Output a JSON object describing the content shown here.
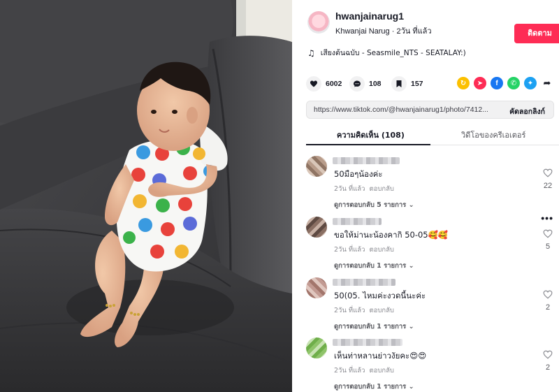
{
  "author": {
    "username": "hwanjainarug1",
    "display_name": "Khwanjai Narug",
    "time_ago": "2วัน ที่แล้ว",
    "follow_label": "ติดตาม"
  },
  "music": {
    "label": "เสียงต้นฉบับ - Seasmile_NTS - SEATALAY:)"
  },
  "stats": {
    "likes": "6002",
    "comments": "108",
    "saves": "157"
  },
  "link": {
    "url": "https://www.tiktok.com/@hwanjainarug1/photo/7412...",
    "copy_label": "คัดลอกลิงก์"
  },
  "tabs": [
    {
      "label": "ความคิดเห็น (108)"
    },
    {
      "label": "วิดีโอของครีเอเตอร์"
    }
  ],
  "comments": [
    {
      "text": "50มือๆน้องค่ะ",
      "time": "2วัน ที่แล้ว",
      "reply": "ตอบกลับ",
      "replies": "ดูการตอบกลับ 5 รายการ ⌄",
      "likes": "22"
    },
    {
      "text": "ขอให้ม่านะน้องคากิ 50-05🥰🥰",
      "time": "2วัน ที่แล้ว",
      "reply": "ตอบกลับ",
      "replies": "ดูการตอบกลับ 1 รายการ ⌄",
      "likes": "5"
    },
    {
      "text": "50(05. ไหมค่ะงวดนี้นะค่ะ",
      "time": "2วัน ที่แล้ว",
      "reply": "ตอบกลับ",
      "replies": "ดูการตอบกลับ 1 รายการ ⌄",
      "likes": "2"
    },
    {
      "text": "เห็นท่าหลานย่าวงัยคะ😍😍",
      "time": "2วัน ที่แล้ว",
      "reply": "ตอบกลับ",
      "replies": "ดูการตอบกลับ 1 รายการ ⌄",
      "likes": "2"
    }
  ],
  "colors": {
    "accent": "#fe2c55",
    "text": "#161823",
    "muted": "#8a8b91",
    "sofa": "#3c3c3f"
  },
  "icons": {
    "music": "music-note-icon",
    "like": "heart-icon",
    "comment": "comment-bubble-icon",
    "save": "bookmark-icon",
    "share": [
      "repost-icon",
      "send-icon",
      "facebook-icon",
      "whatsapp-icon",
      "twitter-icon",
      "forward-icon"
    ]
  }
}
